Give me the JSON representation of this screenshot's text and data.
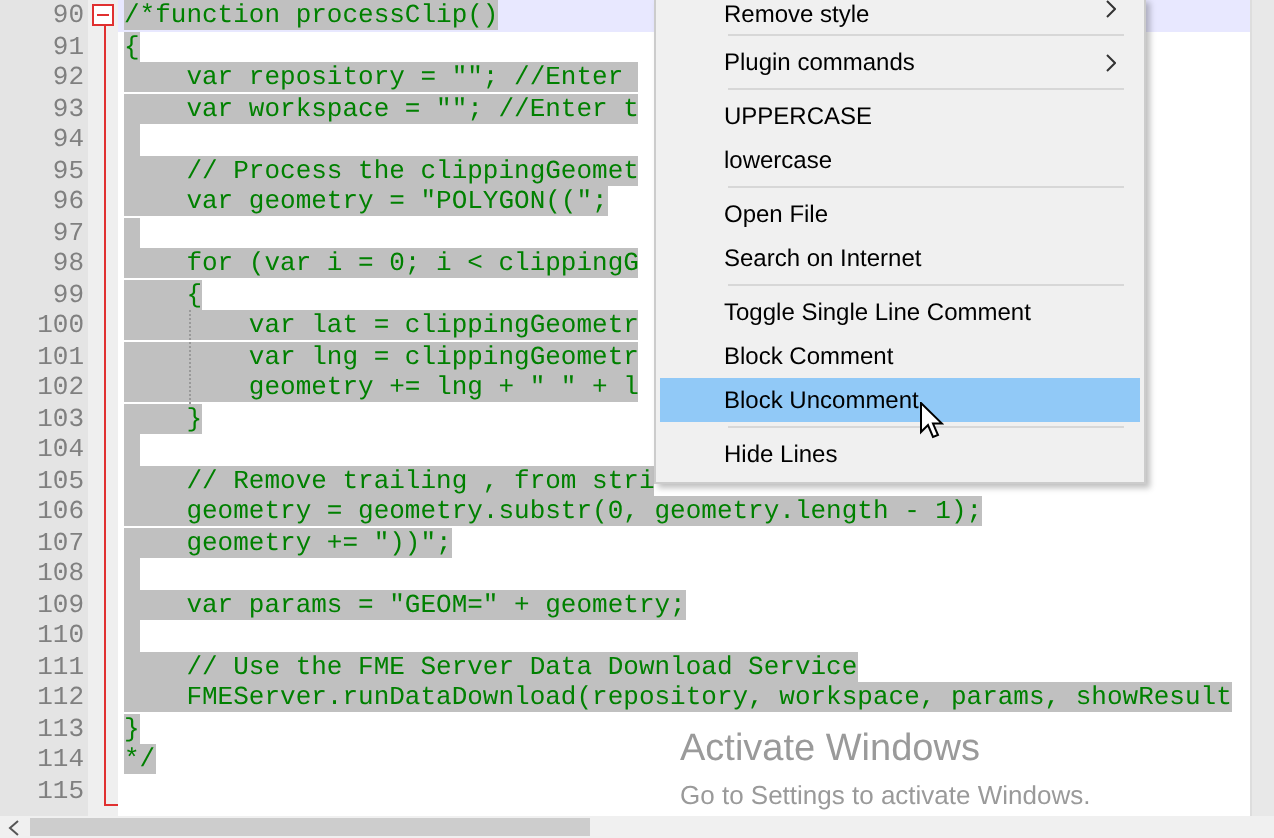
{
  "editor": {
    "lines": [
      {
        "number": "90",
        "text": "/*function processClip()",
        "selected": true,
        "current": true,
        "fold": true
      },
      {
        "number": "91",
        "text": "{",
        "selected": true,
        "current": false,
        "fold": false
      },
      {
        "number": "92",
        "text": "    var repository = \"\"; //Enter ",
        "selected": true,
        "current": false,
        "fold": false
      },
      {
        "number": "93",
        "text": "    var workspace = \"\"; //Enter t",
        "selected": true,
        "current": false,
        "fold": false
      },
      {
        "number": "94",
        "selected": true,
        "current": false,
        "fold": false
      },
      {
        "number": "95",
        "text": "    // Process the clippingGeomet",
        "selected": true,
        "current": false,
        "fold": false
      },
      {
        "number": "96",
        "text": "    var geometry = \"POLYGON((\";",
        "selected": true,
        "current": false,
        "fold": false
      },
      {
        "number": "97",
        "selected": true,
        "current": false,
        "fold": false
      },
      {
        "number": "98",
        "text": "    for (var i = 0; i < clippingG",
        "selected": true,
        "current": false,
        "fold": false
      },
      {
        "number": "99",
        "text": "    {",
        "selected": true,
        "current": false,
        "fold": false
      },
      {
        "number": "100",
        "text": "        var lat = clippingGeometr",
        "selected": true,
        "current": false,
        "fold": false
      },
      {
        "number": "101",
        "text": "        var lng = clippingGeometr",
        "selected": true,
        "current": false,
        "fold": false
      },
      {
        "number": "102",
        "text": "        geometry += lng + \" \" + l",
        "selected": true,
        "current": false,
        "fold": false
      },
      {
        "number": "103",
        "text": "    }",
        "selected": true,
        "current": false,
        "fold": false
      },
      {
        "number": "104",
        "selected": true,
        "current": false,
        "fold": false
      },
      {
        "number": "105",
        "text": "    // Remove trailing , from stri",
        "selected": true,
        "current": false,
        "fold": false
      },
      {
        "number": "106",
        "text": "    geometry = geometry.substr(0, geometry.length - 1);",
        "selected": true,
        "current": false,
        "fold": false
      },
      {
        "number": "107",
        "text": "    geometry += \"))\";",
        "selected": true,
        "current": false,
        "fold": false
      },
      {
        "number": "108",
        "selected": true,
        "current": false,
        "fold": false
      },
      {
        "number": "109",
        "text": "    var params = \"GEOM=\" + geometry;",
        "selected": true,
        "current": false,
        "fold": false
      },
      {
        "number": "110",
        "selected": true,
        "current": false,
        "fold": false
      },
      {
        "number": "111",
        "text": "    // Use the FME Server Data Download Service",
        "selected": true,
        "current": false,
        "fold": false
      },
      {
        "number": "112",
        "text": "    FMEServer.runDataDownload(repository, workspace, params, showResult",
        "selected": true,
        "current": false,
        "fold": false
      },
      {
        "number": "113",
        "text": "}",
        "selected": true,
        "current": false,
        "fold": false
      },
      {
        "number": "114",
        "text": "*/",
        "selected": true,
        "current": false,
        "fold": false
      },
      {
        "number": "115",
        "selected": false,
        "current": false,
        "fold": false
      }
    ]
  },
  "context_menu": {
    "items": [
      {
        "kind": "item",
        "label": "Remove style",
        "submenu": true,
        "selected": false
      },
      {
        "kind": "separator"
      },
      {
        "kind": "item",
        "label": "Plugin commands",
        "submenu": true,
        "selected": false
      },
      {
        "kind": "separator"
      },
      {
        "kind": "item",
        "label": "UPPERCASE",
        "submenu": false,
        "selected": false
      },
      {
        "kind": "item",
        "label": "lowercase",
        "submenu": false,
        "selected": false
      },
      {
        "kind": "separator"
      },
      {
        "kind": "item",
        "label": "Open File",
        "submenu": false,
        "selected": false
      },
      {
        "kind": "item",
        "label": "Search on Internet",
        "submenu": false,
        "selected": false
      },
      {
        "kind": "separator"
      },
      {
        "kind": "item",
        "label": "Toggle Single Line Comment",
        "submenu": false,
        "selected": false
      },
      {
        "kind": "item",
        "label": "Block Comment",
        "submenu": false,
        "selected": false
      },
      {
        "kind": "item",
        "label": "Block Uncomment",
        "submenu": false,
        "selected": true
      },
      {
        "kind": "separator"
      },
      {
        "kind": "item",
        "label": "Hide Lines",
        "submenu": false,
        "selected": false
      }
    ]
  },
  "activation_notice": {
    "title": "Activate Windows",
    "subtitle": "Go to Settings to activate Windows."
  }
}
